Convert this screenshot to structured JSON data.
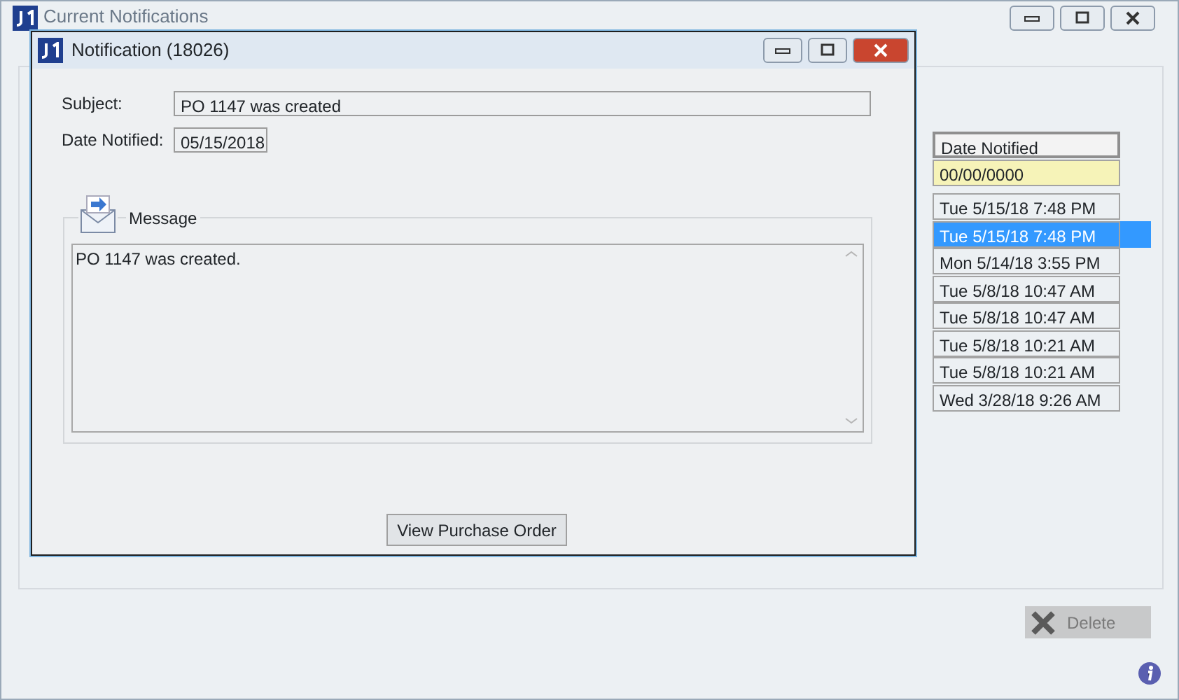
{
  "main_window": {
    "title": "Current Notifications",
    "table": {
      "columns": [
        "Date Notified"
      ],
      "filter": "00/00/0000",
      "rows": [
        {
          "date_notified": "Tue 5/15/18 7:48 PM",
          "selected": false
        },
        {
          "date_notified": "Tue 5/15/18 7:48 PM",
          "selected": true
        },
        {
          "date_notified": "Mon 5/14/18 3:55 PM",
          "selected": false
        },
        {
          "date_notified": "Tue 5/8/18 10:47 AM",
          "selected": false
        },
        {
          "date_notified": "Tue 5/8/18 10:47 AM",
          "selected": false
        },
        {
          "date_notified": "Tue 5/8/18 10:21 AM",
          "selected": false
        },
        {
          "date_notified": "Tue 5/8/18 10:21 AM",
          "selected": false
        },
        {
          "date_notified": "Wed 3/28/18 9:26 AM",
          "selected": false
        }
      ]
    },
    "delete_button": {
      "label": "Delete",
      "disabled": true
    }
  },
  "dialog": {
    "title": "Notification (18026)",
    "subject_label": "Subject:",
    "subject": "PO 1147 was created",
    "date_label": "Date Notified:",
    "date": "05/15/2018",
    "message_label": "Message",
    "message": "PO 1147 was created.",
    "button": "View Purchase Order"
  }
}
